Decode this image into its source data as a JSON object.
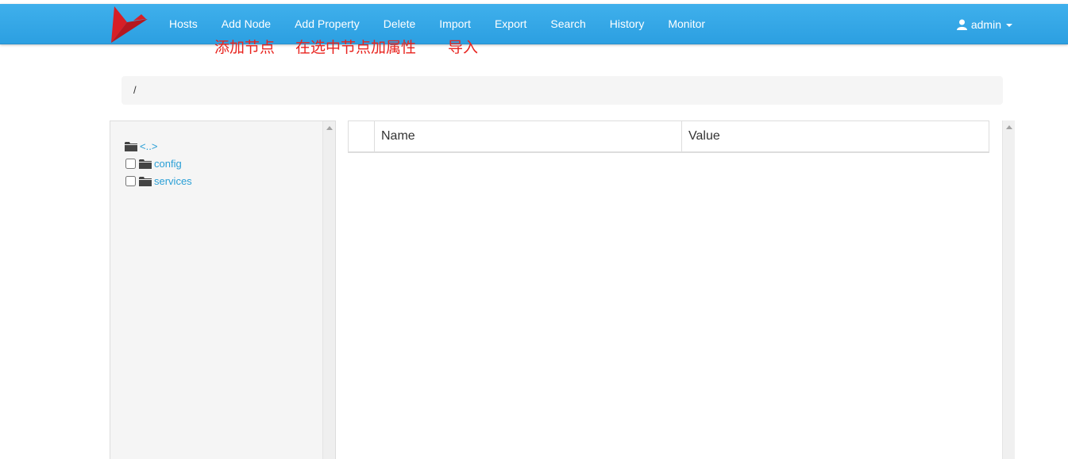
{
  "navbar": {
    "items": [
      {
        "label": "Hosts"
      },
      {
        "label": "Add Node"
      },
      {
        "label": "Add Property"
      },
      {
        "label": "Delete"
      },
      {
        "label": "Import"
      },
      {
        "label": "Export"
      },
      {
        "label": "Search"
      },
      {
        "label": "History"
      },
      {
        "label": "Monitor"
      }
    ],
    "user": "admin",
    "color": "#2c9fe1"
  },
  "annotations": [
    {
      "text": "添加节点"
    },
    {
      "text": "在选中节点加属性"
    },
    {
      "text": "导入"
    }
  ],
  "breadcrumb": "/",
  "tree": {
    "parent": {
      "label": "<..>"
    },
    "nodes": [
      {
        "label": "config",
        "checked": false
      },
      {
        "label": "services",
        "checked": false
      }
    ]
  },
  "table": {
    "headers": [
      "Name",
      "Value"
    ],
    "rows": []
  },
  "colors": {
    "annotation": "#e8231e",
    "link": "#2a9fd6",
    "logo": "#d71f26"
  }
}
